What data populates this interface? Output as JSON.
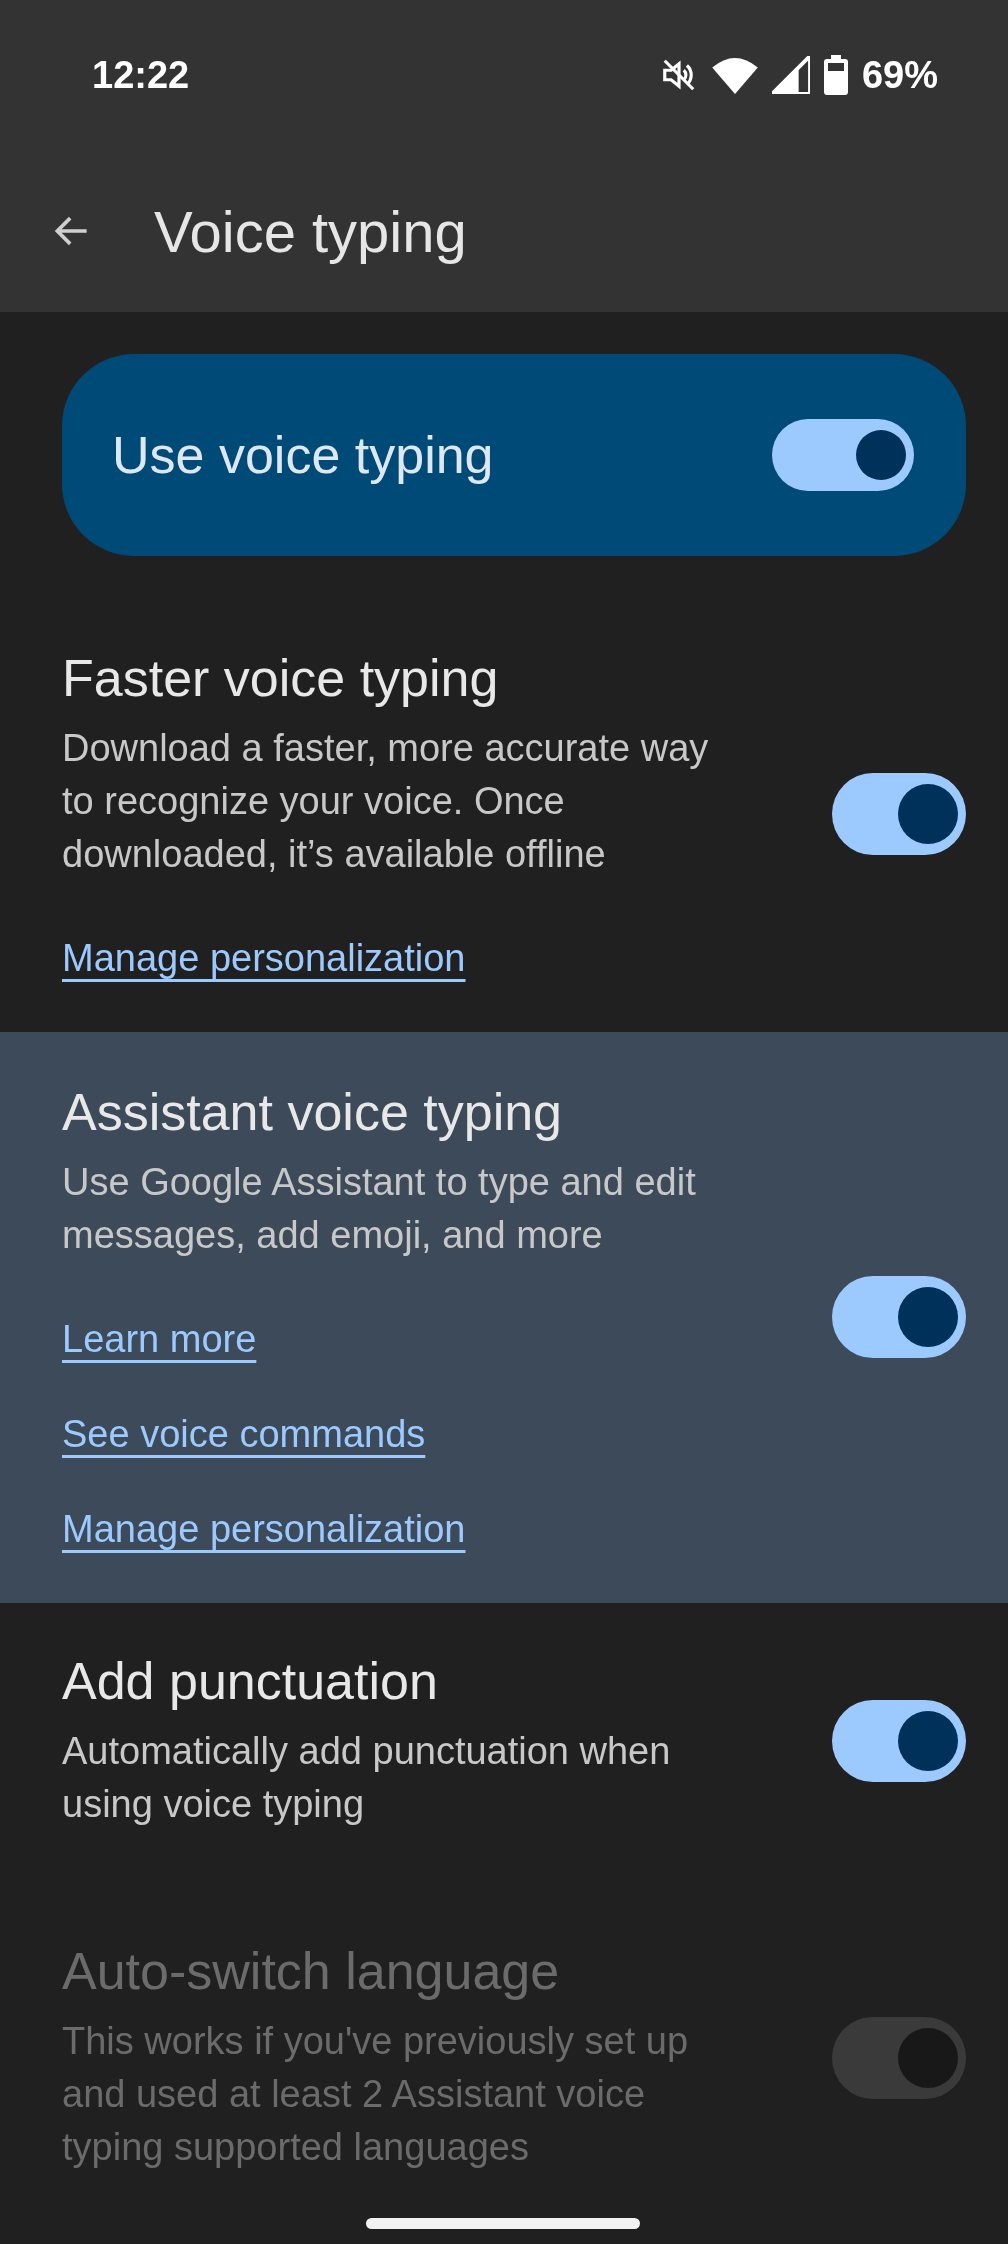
{
  "status_bar": {
    "time": "12:22",
    "battery": "69%"
  },
  "app_bar": {
    "title": "Voice typing"
  },
  "main_switch": {
    "label": "Use voice typing",
    "on": true
  },
  "sections": [
    {
      "title": "Faster voice typing",
      "description": "Download a faster, more accurate way to recognize your voice. Once downloaded, it’s available offline",
      "on": true,
      "disabled": false,
      "highlighted": false,
      "links": [
        "Manage personalization"
      ]
    },
    {
      "title": "Assistant voice typing",
      "description": "Use Google Assistant to type and edit messages, add emoji, and more",
      "on": true,
      "disabled": false,
      "highlighted": true,
      "links": [
        "Learn more",
        "See voice commands",
        "Manage personalization"
      ]
    },
    {
      "title": "Add punctuation",
      "description": "Automatically add punctuation when using voice typing",
      "on": true,
      "disabled": false,
      "highlighted": false
    },
    {
      "title": "Auto-switch language",
      "description": "This works if you've previously set up and used at least 2 Assistant voice typing supported languages",
      "on": false,
      "disabled": true,
      "highlighted": false
    }
  ]
}
